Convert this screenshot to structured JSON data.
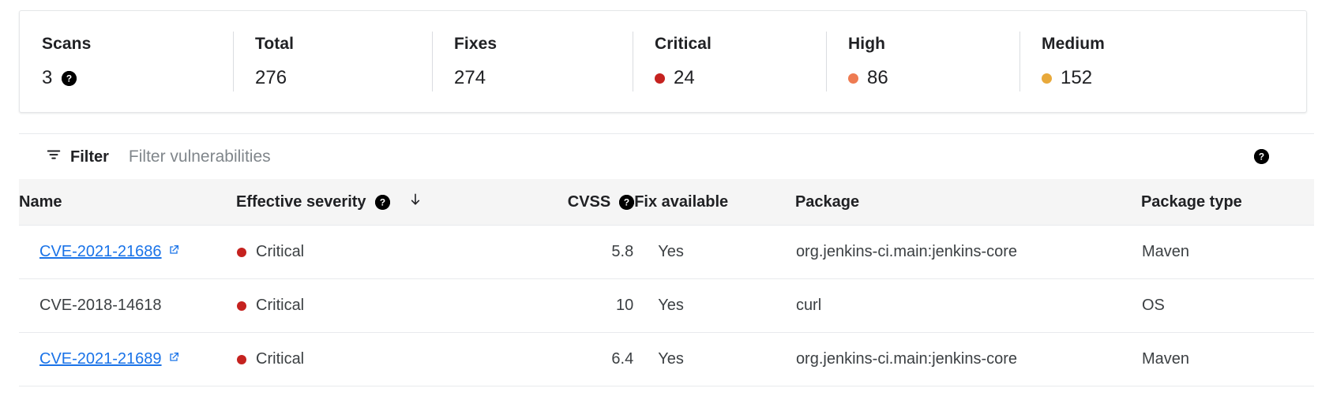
{
  "summary": {
    "stats": [
      {
        "label": "Scans",
        "value": "3",
        "dot_color": null,
        "help": true,
        "help_icon": "help-icon"
      },
      {
        "label": "Total",
        "value": "276",
        "dot_color": null,
        "help": false,
        "help_icon": null
      },
      {
        "label": "Fixes",
        "value": "274",
        "dot_color": null,
        "help": false,
        "help_icon": null
      },
      {
        "label": "Critical",
        "value": "24",
        "dot_color": "#C5221F",
        "help": false,
        "help_icon": null
      },
      {
        "label": "High",
        "value": "86",
        "dot_color": "#EE7B52",
        "help": false,
        "help_icon": null
      },
      {
        "label": "Medium",
        "value": "152",
        "dot_color": "#E8A93B",
        "help": false,
        "help_icon": null
      }
    ]
  },
  "filter_bar": {
    "icon": "filter-icon",
    "label": "Filter",
    "input_value": "",
    "placeholder": "Filter vulnerabilities",
    "help_icon": "help-icon"
  },
  "table": {
    "columns": [
      {
        "key": "name",
        "label": "Name",
        "help": false,
        "sort": null,
        "align": "left"
      },
      {
        "key": "severity",
        "label": "Effective severity",
        "help": true,
        "sort": "desc",
        "align": "left"
      },
      {
        "key": "cvss",
        "label": "CVSS",
        "help": true,
        "sort": null,
        "align": "right"
      },
      {
        "key": "fix",
        "label": "Fix available",
        "help": false,
        "sort": null,
        "align": "left"
      },
      {
        "key": "package",
        "label": "Package",
        "help": false,
        "sort": null,
        "align": "left"
      },
      {
        "key": "package_type",
        "label": "Package type",
        "help": false,
        "sort": null,
        "align": "left"
      }
    ],
    "sort_arrow_glyph": "↓",
    "rows": [
      {
        "name": "CVE-2021-21686",
        "is_link": true,
        "external_icon": "external-link-icon",
        "severity": "Critical",
        "severity_color": "#C5221F",
        "cvss": "5.8",
        "fix": "Yes",
        "package": "org.jenkins-ci.main:jenkins-core",
        "package_type": "Maven"
      },
      {
        "name": "CVE-2018-14618",
        "is_link": false,
        "external_icon": null,
        "severity": "Critical",
        "severity_color": "#C5221F",
        "cvss": "10",
        "fix": "Yes",
        "package": "curl",
        "package_type": "OS"
      },
      {
        "name": "CVE-2021-21689",
        "is_link": true,
        "external_icon": "external-link-icon",
        "severity": "Critical",
        "severity_color": "#C5221F",
        "cvss": "6.4",
        "fix": "Yes",
        "package": "org.jenkins-ci.main:jenkins-core",
        "package_type": "Maven"
      }
    ]
  },
  "colors": {
    "link": "#1a73e8",
    "critical": "#C5221F",
    "high": "#EE7B52",
    "medium": "#E8A93B",
    "header_bg": "#f5f5f5",
    "border": "#e8eaed"
  }
}
